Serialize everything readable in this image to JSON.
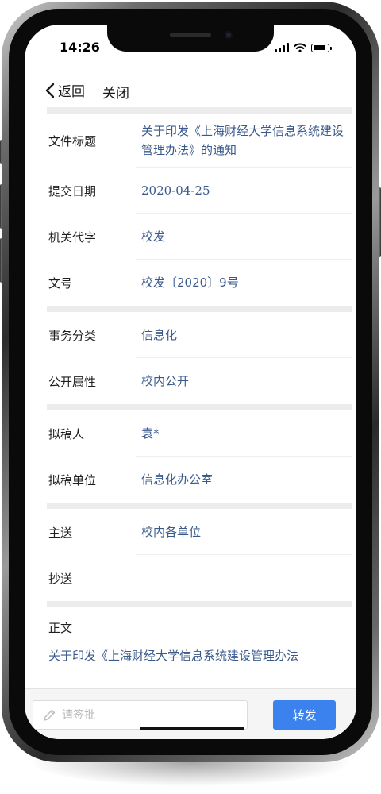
{
  "status_bar": {
    "time": "14:26",
    "icons": [
      "signal-icon",
      "wifi-icon",
      "battery-icon"
    ]
  },
  "nav": {
    "back_label": "返回",
    "close_label": "关闭"
  },
  "details": {
    "title_label": "文件标题",
    "title_value": "关于印发《上海财经大学信息系统建设管理办法》的通知",
    "date_label": "提交日期",
    "date_value": "2020-04-25",
    "agency_label": "机关代字",
    "agency_value": "校发",
    "doc_no_label": "文号",
    "doc_no_value": "校发〔2020〕9号",
    "category_label": "事务分类",
    "category_value": "信息化",
    "public_label": "公开属性",
    "public_value": "校内公开",
    "drafter_label": "拟稿人",
    "drafter_value": "袁*",
    "dept_label": "拟稿单位",
    "dept_value": "信息化办公室",
    "to_label": "主送",
    "to_value": "校内各单位",
    "cc_label": "抄送",
    "cc_value": "",
    "body_label": "正文",
    "body_preview": "关于印发《上海财经大学信息系统建设管理办法"
  },
  "bottom_bar": {
    "sign_placeholder": "请签批",
    "forward_label": "转发"
  },
  "colors": {
    "accent": "#3c82ee",
    "value_text": "#3a5a8c",
    "label_text": "#1f1f1f",
    "section_gap": "#ececec"
  }
}
